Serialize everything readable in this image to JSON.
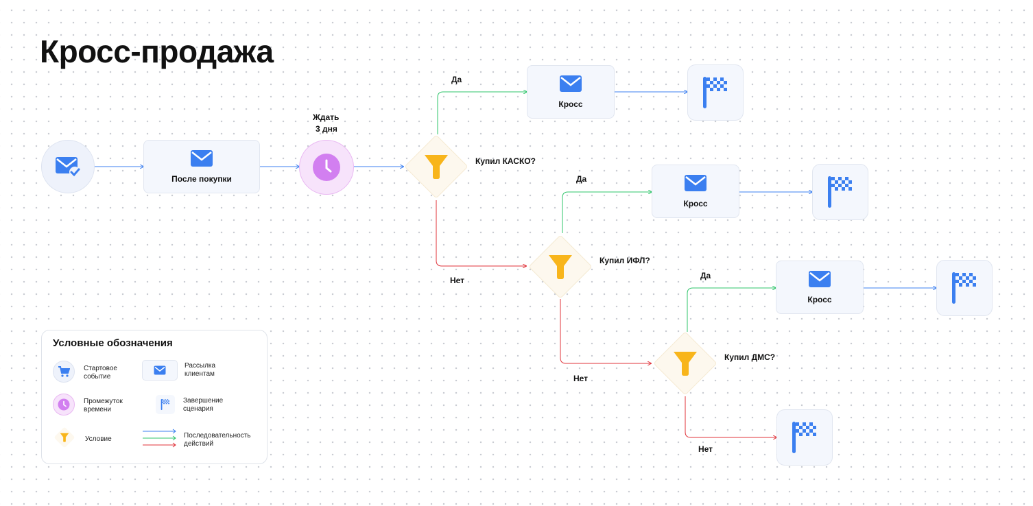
{
  "title": "Кросс-продажа",
  "nodes": {
    "start": {
      "icon": "mail-check-icon"
    },
    "after_purchase": {
      "label": "После покупки",
      "icon": "mail-icon"
    },
    "wait": {
      "label_line1": "Ждать",
      "label_line2": "3 дня",
      "icon": "clock-icon"
    },
    "cond1": {
      "label": "Купил КАСКО?",
      "icon": "funnel-icon"
    },
    "cond2": {
      "label": "Купил ИФЛ?",
      "icon": "funnel-icon"
    },
    "cond3": {
      "label": "Купил ДМС?",
      "icon": "funnel-icon"
    },
    "cross1": {
      "label": "Кросс",
      "icon": "mail-icon"
    },
    "cross2": {
      "label": "Кросс",
      "icon": "mail-icon"
    },
    "cross3": {
      "label": "Кросс",
      "icon": "mail-icon"
    },
    "end_icon": "checkered-flag-icon"
  },
  "edges": {
    "yes": "Да",
    "no": "Нет"
  },
  "legend": {
    "title": "Условные обозначения",
    "start_l1": "Стартовое",
    "start_l2": "событие",
    "mail_l1": "Рассылка",
    "mail_l2": "клиентам",
    "timer_l1": "Промежуток",
    "timer_l2": "времени",
    "end_l1": "Завершение",
    "end_l2": "сценария",
    "cond": "Условие",
    "seq_l1": "Последовательность",
    "seq_l2": "действий"
  },
  "colors": {
    "blue": "#3b7ff0",
    "green": "#2ec46a",
    "red": "#e0333a",
    "purple": "#d27ff0",
    "yellow": "#f8b51b"
  }
}
